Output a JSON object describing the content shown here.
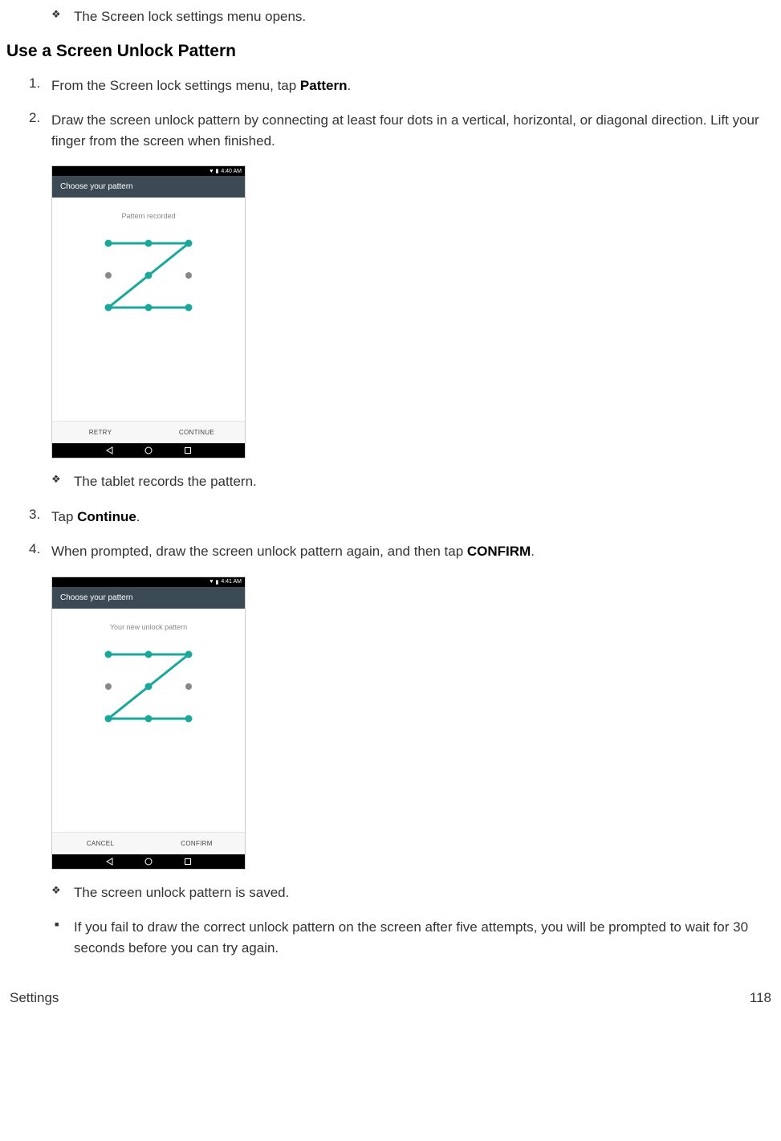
{
  "intro_bullet": "The Screen lock settings menu opens.",
  "section_title": "Use a Screen Unlock Pattern",
  "steps": {
    "s1_pre": "From the Screen lock settings menu, tap ",
    "s1_bold": "Pattern",
    "s1_post": ".",
    "s2": "Draw the screen unlock pattern by connecting at least four dots in a vertical, horizontal, or diagonal direction. Lift your finger from the screen when finished.",
    "s2_result": "The tablet records the pattern.",
    "s3_pre": "Tap ",
    "s3_bold": "Continue",
    "s3_post": ".",
    "s4_pre": "When prompted, draw the screen unlock pattern again, and then tap ",
    "s4_bold": "CONFIRM",
    "s4_post": ".",
    "s4_result": "The screen unlock pattern is saved.",
    "note": "If you fail to draw the correct unlock pattern on the screen after five attempts, you will be prompted to wait for 30 seconds before you can try again."
  },
  "phone1": {
    "time": "4:40 AM",
    "title": "Choose your pattern",
    "message": "Pattern recorded",
    "left_btn": "RETRY",
    "right_btn": "CONTINUE"
  },
  "phone2": {
    "time": "4:41 AM",
    "title": "Choose your pattern",
    "message": "Your new unlock pattern",
    "left_btn": "CANCEL",
    "right_btn": "CONFIRM"
  },
  "footer": {
    "left": "Settings",
    "right": "118"
  }
}
